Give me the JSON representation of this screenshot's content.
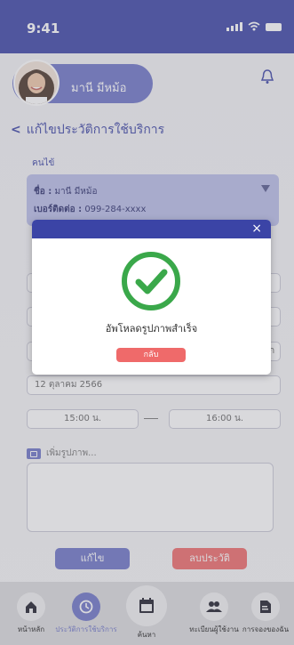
{
  "status": {
    "time": "9:41"
  },
  "profile": {
    "name": "มานี มีหม้อ"
  },
  "header": {
    "back_label": "แก้ไขประวัติการใช้บริการ"
  },
  "form": {
    "user_label": "คนไข้",
    "name_label": "ชื่อ :",
    "name_value": "มานี มีหม้อ",
    "phone_label": "เบอร์ติดต่อ :",
    "phone_value": "099-284-xxxx",
    "partial_hint": "ภ",
    "date_value": "12 ตุลาคม 2566",
    "time_start": "15:00 น.",
    "time_end": "16:00 น.",
    "add_photo_label": "เพิ่มรูปภาพ...",
    "edit_button": "แก้ไข",
    "delete_button": "ลบประวัติ"
  },
  "modal": {
    "message": "อัพโหลดรูปภาพสำเร็จ",
    "back_button": "กลับ",
    "close_symbol": "×"
  },
  "tabs": [
    {
      "label": "หน้าหลัก",
      "icon": "home-icon",
      "active": false
    },
    {
      "label": "ประวัติการใช้บริการ",
      "icon": "history-icon",
      "active": true
    },
    {
      "label": "ค้นหา",
      "icon": "calendar-icon",
      "active": false
    },
    {
      "label": "ทะเบียนผู้ใช้งาน",
      "icon": "users-icon",
      "active": false
    },
    {
      "label": "การจองของฉัน",
      "icon": "document-icon",
      "active": false
    }
  ],
  "colors": {
    "primary": "#3b44a6",
    "accent": "#6d74c8",
    "danger": "#ef6a6a",
    "success": "#3aa84a"
  }
}
